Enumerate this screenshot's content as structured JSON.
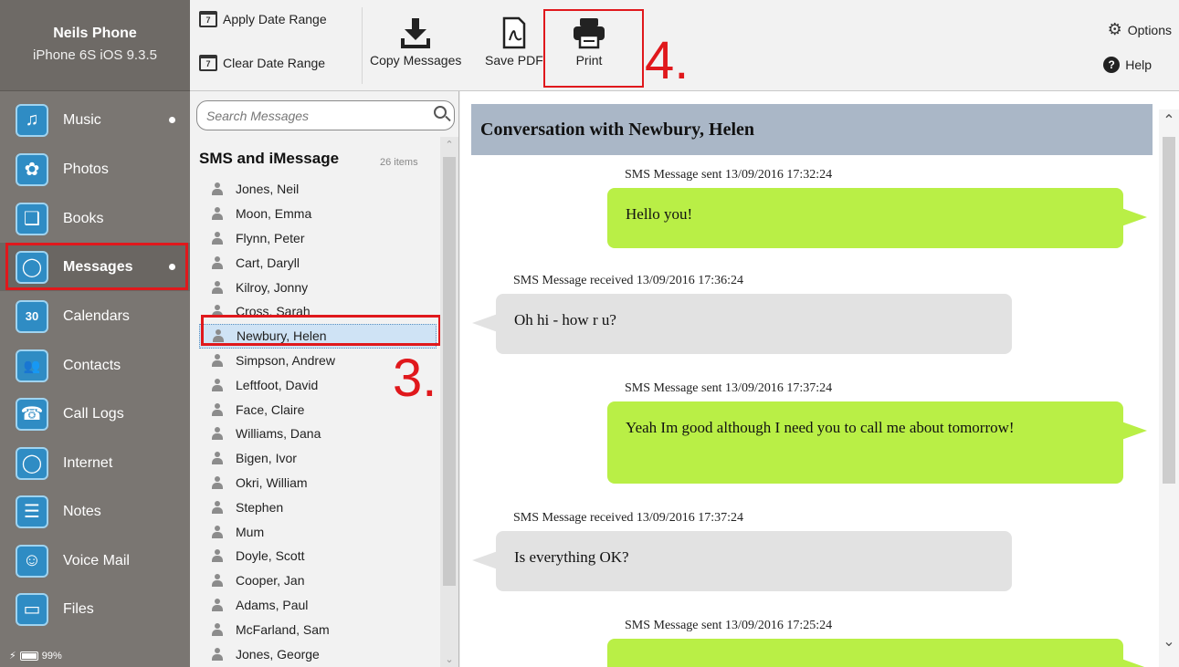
{
  "device": {
    "name": "Neils Phone",
    "model": "iPhone 6S iOS 9.3.5",
    "battery": "99%"
  },
  "nav": [
    {
      "label": "Music",
      "glyph": "♫",
      "dot": true
    },
    {
      "label": "Photos",
      "glyph": "✿",
      "dot": false
    },
    {
      "label": "Books",
      "glyph": "❑",
      "dot": false
    },
    {
      "label": "Messages",
      "glyph": "◯",
      "dot": true,
      "active": true
    },
    {
      "label": "Calendars",
      "glyph": "30",
      "dot": false
    },
    {
      "label": "Contacts",
      "glyph": "👥",
      "dot": false
    },
    {
      "label": "Call Logs",
      "glyph": "☎",
      "dot": false
    },
    {
      "label": "Internet",
      "glyph": "◯",
      "dot": false
    },
    {
      "label": "Notes",
      "glyph": "☰",
      "dot": false
    },
    {
      "label": "Voice Mail",
      "glyph": "☺",
      "dot": false
    },
    {
      "label": "Files",
      "glyph": "▭",
      "dot": false
    }
  ],
  "toolbar": {
    "apply_date": "Apply Date Range",
    "clear_date": "Clear Date Range",
    "copy": "Copy Messages",
    "save_pdf": "Save PDF",
    "print": "Print",
    "options": "Options",
    "help": "Help",
    "calendar_glyph": "7"
  },
  "annotations": {
    "step3": "3.",
    "step4": "4."
  },
  "search": {
    "placeholder": "Search Messages"
  },
  "list": {
    "header": "SMS and iMessage",
    "count": "26 items",
    "selected": "Newbury, Helen",
    "contacts": [
      "Jones, Neil",
      "Moon, Emma",
      "Flynn, Peter",
      "Cart, Daryll",
      "Kilroy, Jonny",
      "Cross, Sarah",
      "Newbury, Helen",
      "Simpson, Andrew",
      "Leftfoot, David",
      "Face, Claire",
      "Williams, Dana",
      "Bigen, Ivor",
      "Okri, William",
      "Stephen",
      "Mum",
      "Doyle, Scott",
      "Cooper, Jan",
      "Adams, Paul",
      "McFarland, Sam",
      "Jones, George"
    ]
  },
  "conversation": {
    "title": "Conversation with Newbury, Helen",
    "messages": [
      {
        "meta": "SMS Message sent 13/09/2016 17:32:24",
        "text": "Hello you!",
        "dir": "sent"
      },
      {
        "meta": "SMS Message received 13/09/2016 17:36:24",
        "text": "Oh hi - how r u?",
        "dir": "recv"
      },
      {
        "meta": "SMS Message sent 13/09/2016 17:37:24",
        "text": "Yeah Im good although I need you to call me about tomorrow!",
        "dir": "sent"
      },
      {
        "meta": "SMS Message received 13/09/2016 17:37:24",
        "text": "Is everything OK?",
        "dir": "recv"
      },
      {
        "meta": "SMS Message sent 13/09/2016 17:25:24",
        "text": "",
        "dir": "sent"
      }
    ]
  }
}
